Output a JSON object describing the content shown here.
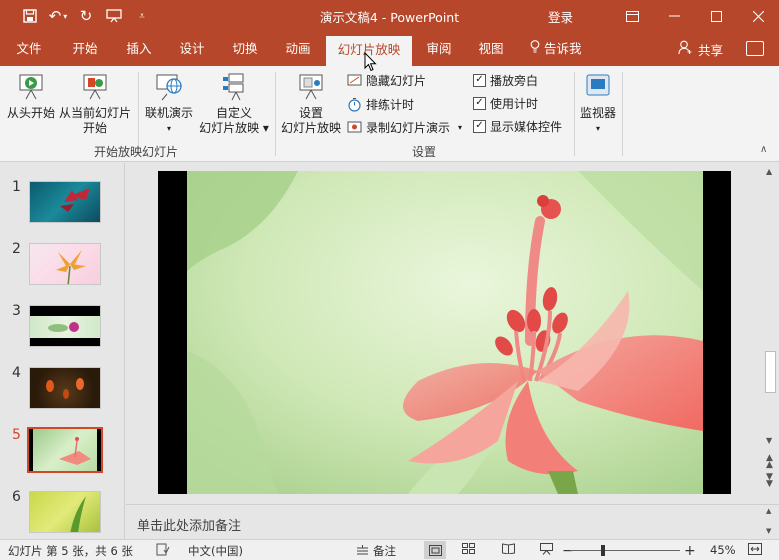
{
  "window": {
    "title": "演示文稿4 - PowerPoint",
    "login": "登录"
  },
  "tabs": [
    {
      "label": "文件"
    },
    {
      "label": "开始"
    },
    {
      "label": "插入"
    },
    {
      "label": "设计"
    },
    {
      "label": "切换"
    },
    {
      "label": "动画"
    },
    {
      "label": "幻灯片放映",
      "active": true
    },
    {
      "label": "审阅"
    },
    {
      "label": "视图"
    }
  ],
  "tell_me": "告诉我",
  "share": "共享",
  "ribbon": {
    "group_start": {
      "from_beginning": "从头开始",
      "from_current_1": "从当前幻灯片",
      "from_current_2": "开始",
      "online": "联机演示",
      "custom_1": "自定义",
      "custom_2": "幻灯片放映",
      "label": "开始放映幻灯片"
    },
    "group_setup": {
      "setup_1": "设置",
      "setup_2": "幻灯片放映",
      "hide_slide": "隐藏幻灯片",
      "rehearse": "排练计时",
      "record": "录制幻灯片演示",
      "play_narrations": "播放旁白",
      "use_timings": "使用计时",
      "show_media_controls": "显示媒体控件",
      "label": "设置"
    },
    "group_monitors": {
      "monitor": "监视器"
    }
  },
  "slides": [
    {
      "num": "1"
    },
    {
      "num": "2"
    },
    {
      "num": "3"
    },
    {
      "num": "4"
    },
    {
      "num": "5",
      "selected": true
    },
    {
      "num": "6"
    }
  ],
  "notes_placeholder": "单击此处添加备注",
  "status": {
    "slide_info": "幻灯片 第 5 张，共 6 张",
    "language": "中文(中国)",
    "notes_btn": "备注",
    "zoom": "45%"
  },
  "colors": {
    "accent": "#b7472a",
    "selected": "#d24726"
  }
}
